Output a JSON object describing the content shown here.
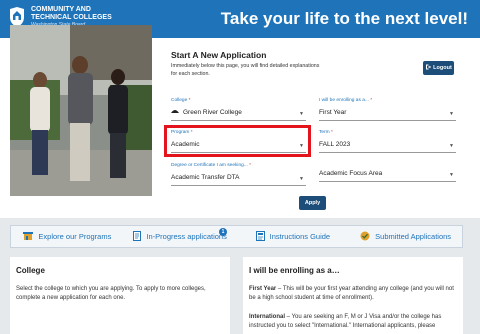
{
  "header": {
    "logo_line1": "COMMUNITY AND",
    "logo_line2": "TECHNICAL COLLEGES",
    "logo_sub": "Washington State Board",
    "tagline": "Take your life to the next level!"
  },
  "form": {
    "title": "Start A New Application",
    "subtitle": "Immediately below this page, you will find detailed explanations for each section.",
    "logout_label": "Logout",
    "apply_label": "Apply",
    "fields": {
      "college": {
        "label": "College",
        "value": "Green River College"
      },
      "enrolling": {
        "label": "I will be enrolling as a...",
        "value": "First Year"
      },
      "program": {
        "label": "Program",
        "value": "Academic"
      },
      "term": {
        "label": "Term",
        "value": "FALL 2023"
      },
      "degree": {
        "label": "Degree or Certificate I am seeking...",
        "value": "Academic Transfer DTA"
      },
      "focus": {
        "label": "",
        "value": "Academic Focus Area"
      }
    },
    "required_mark": "*"
  },
  "nav": {
    "items": [
      {
        "label": "Explore our Programs",
        "icon": "building-icon"
      },
      {
        "label": "In-Progress applications",
        "icon": "document-icon"
      },
      {
        "label": "Instructions Guide",
        "icon": "guide-icon"
      },
      {
        "label": "Submitted Applications",
        "icon": "checklist-icon"
      }
    ],
    "badge_count": "1"
  },
  "cards": {
    "college": {
      "title": "College",
      "body": "Select the college to which you are applying. To apply to more colleges, complete a new application for each one."
    },
    "enrolling": {
      "title": "I will be enrolling as a…",
      "first_year_label": "First Year",
      "first_year_text": " – This will be your first year attending any college (and you will not be a high school student at time of enrollment).",
      "international_label": "International",
      "international_text": " – You are seeking an F, M or J Visa and/or the college has instructed you to select \"International.\" International applicants, please"
    }
  },
  "colors": {
    "brand_blue": "#1e73b9",
    "button_navy": "#1d4e79",
    "highlight_red": "#e3141b"
  }
}
